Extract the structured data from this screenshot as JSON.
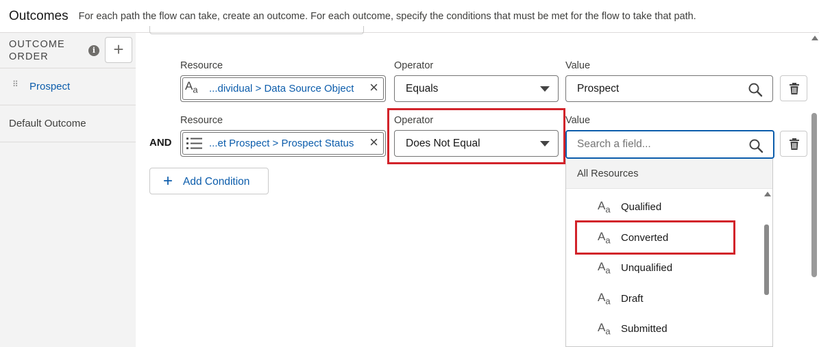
{
  "header": {
    "title": "Outcomes",
    "description": "For each path the flow can take, create an outcome. For each outcome, specify the conditions that must be met for the flow to take that path."
  },
  "sidebar": {
    "order_label_line1": "OUTCOME",
    "order_label_line2": "ORDER",
    "info_glyph": "i",
    "add_glyph": "+",
    "items": [
      {
        "label": "Prospect",
        "selected": true
      },
      {
        "label": "Default Outcome",
        "selected": false
      }
    ]
  },
  "conditions": [
    {
      "resource_label": "Resource",
      "resource_value": "...dividual > Data Source Object",
      "resource_icon": "text-icon",
      "operator_label": "Operator",
      "operator_value": "Equals",
      "value_label": "Value",
      "value_value": "Prospect"
    },
    {
      "connector": "AND",
      "resource_label": "Resource",
      "resource_value": "...et Prospect > Prospect Status",
      "resource_icon": "picklist-icon",
      "operator_label": "Operator",
      "operator_value": "Does Not Equal",
      "value_label": "Value",
      "value_placeholder": "Search a field..."
    }
  ],
  "add_condition_label": "Add Condition",
  "dropdown": {
    "header": "All Resources",
    "items": [
      "Qualified",
      "Converted",
      "Unqualified",
      "Draft",
      "Submitted"
    ]
  },
  "colors": {
    "link": "#0b5cab",
    "highlight": "#d2232a",
    "focus_border": "#0b5cab"
  }
}
